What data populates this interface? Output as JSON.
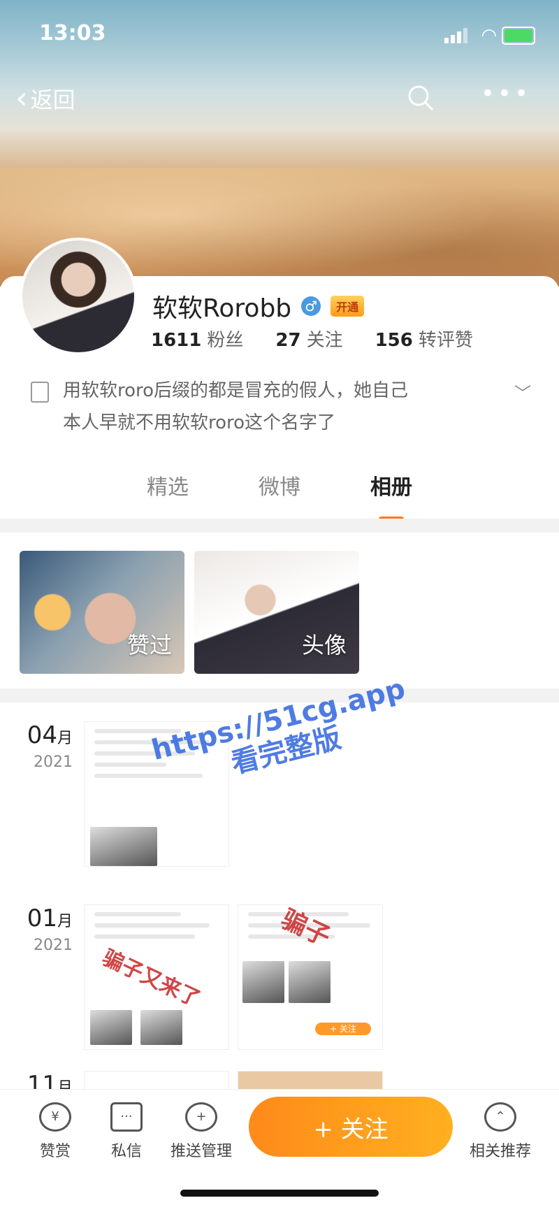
{
  "status": {
    "time": "13:03"
  },
  "nav": {
    "back_label": "返回"
  },
  "profile": {
    "name": "软软Rorobb",
    "gender_symbol": "♂",
    "vip_label": "开通",
    "fans_count": "1611",
    "fans_label": "粉丝",
    "following_count": "27",
    "following_label": "关注",
    "likes_count": "156",
    "likes_label": "转评赞",
    "bio_line1": "用软软roro后缀的都是冒充的假人，她自己",
    "bio_line2": "本人早就不用软软roro这个名字了"
  },
  "tabs": [
    {
      "label": "精选"
    },
    {
      "label": "微博"
    },
    {
      "label": "相册"
    }
  ],
  "active_tab": "相册",
  "albums": [
    {
      "label": "赞过"
    },
    {
      "label": "头像"
    }
  ],
  "timeline": [
    {
      "month": "04",
      "month_unit": "月",
      "year": "2021"
    },
    {
      "month": "01",
      "month_unit": "月",
      "year": "2021"
    },
    {
      "month": "11",
      "month_unit": "月",
      "year": ""
    }
  ],
  "overlays": {
    "watermark_line1": "https://51cg.app",
    "watermark_line2": "看完整版",
    "scam_text1": "骗子",
    "scam_text2": "骗子又来了",
    "follow_small": "+ 关注"
  },
  "bottom_bar": {
    "reward_label": "赞赏",
    "message_label": "私信",
    "push_label": "推送管理",
    "follow_label": "+ 关注",
    "recommend_label": "相关推荐"
  },
  "colors": {
    "accent": "#ff8a1a",
    "verify": "#4a9ae0",
    "scam": "#c62828"
  }
}
